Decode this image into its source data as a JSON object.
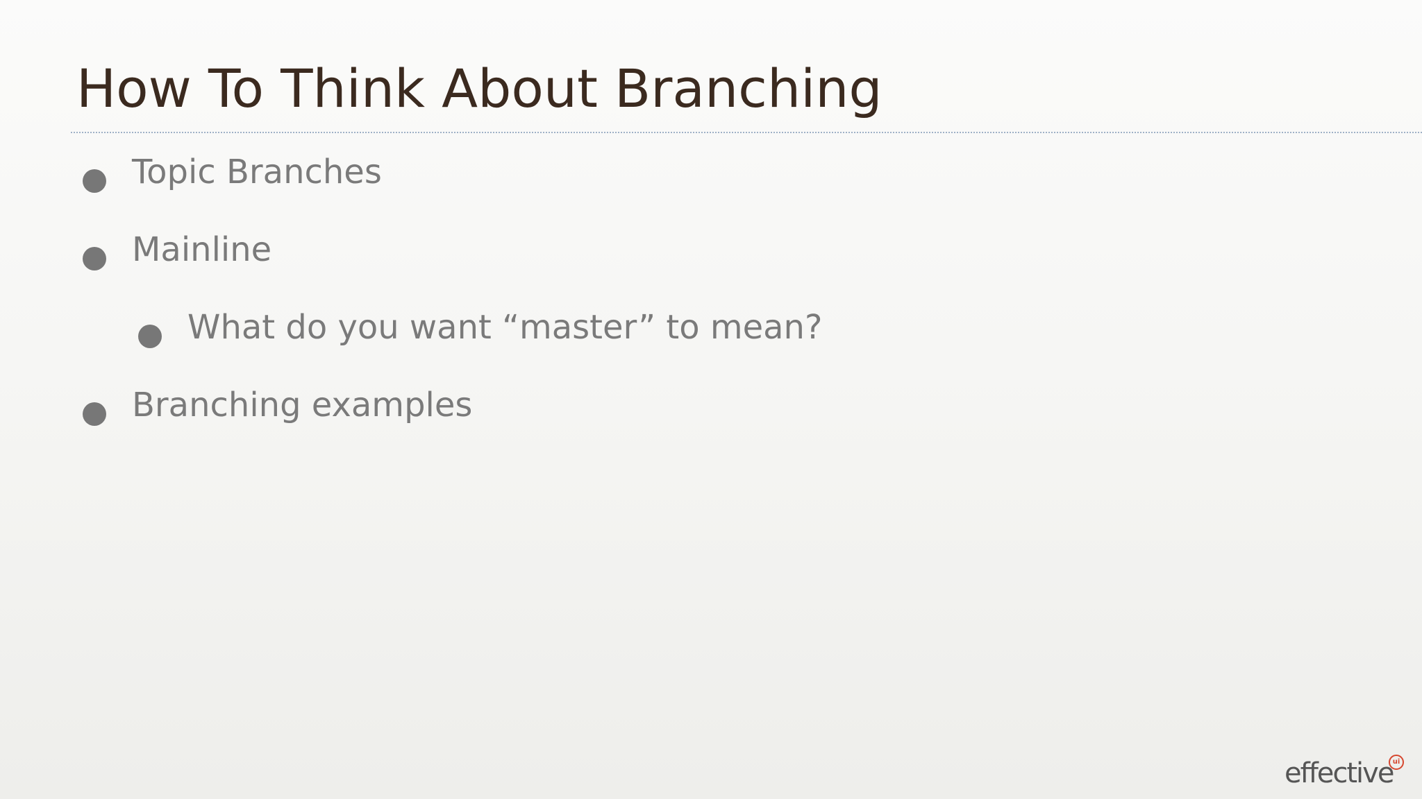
{
  "slide": {
    "title": "How To Think About Branching",
    "bullets": [
      {
        "text": "Topic Branches",
        "level": 1
      },
      {
        "text": "Mainline",
        "level": 1
      },
      {
        "text": "What do you want “master” to mean?",
        "level": 2
      },
      {
        "text": "Branching examples",
        "level": 1
      }
    ]
  },
  "logo": {
    "wordmark": "effective",
    "mark": "ui"
  },
  "colors": {
    "title": "#3b2a1f",
    "bullet_text": "#7a7a7a",
    "bullet_dot": "#777777",
    "rule": "#9fb0c6",
    "logo_accent": "#d6472f"
  }
}
